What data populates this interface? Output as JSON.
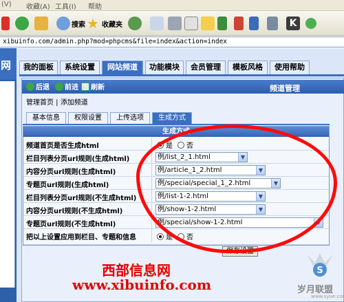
{
  "menubar": {
    "items": [
      "(V)",
      "收藏(A)",
      "工具(I)",
      "帮助"
    ]
  },
  "toolbar": {
    "search_label": "搜索",
    "favorites_label": "收藏夹"
  },
  "address": {
    "url": "xibuinfo.com/admin.php?mod=phpcms&file=index&action=index"
  },
  "sidebar": {
    "label": "网"
  },
  "nav": {
    "tabs": [
      "我的面板",
      "系统设置",
      "网站频道",
      "功能模块",
      "会员管理",
      "模板风格",
      "使用帮助"
    ],
    "active": "网站频道"
  },
  "panel": {
    "back_label": "后退",
    "forward_label": "前进",
    "refresh_label": "刷新",
    "title": "频道管理",
    "breadcrumb": "管理首页 | 添加频道"
  },
  "subtabs": {
    "items": [
      "基本信息",
      "权限设置",
      "上传选项",
      "生成方式"
    ],
    "active": "生成方式"
  },
  "settings": {
    "heading": "生成方式",
    "rows": [
      {
        "label": "频道首页是否生成html",
        "type": "radio",
        "opt1": "是",
        "opt2": "否",
        "selected": "是"
      },
      {
        "label": "栏目列表分页url规则(生成html)",
        "type": "select",
        "value": "例/list_2_1.html"
      },
      {
        "label": "内容分页url规则(生成html)",
        "type": "select",
        "value": "例/article_1_2.html"
      },
      {
        "label": "专题页url规则(生成html)",
        "type": "select",
        "value": "例/special/special_1_2.html"
      },
      {
        "label": "栏目列表分页url规则(不生成html)",
        "type": "select",
        "value": "例/list-1-2.html"
      },
      {
        "label": "内容分页url规则(不生成html)",
        "type": "select",
        "value": "例/show-1-2.html"
      },
      {
        "label": "专题页url规则(不生成html)",
        "type": "select",
        "value": "例/special/show-1-2.html"
      },
      {
        "label": "把以上设置应用到栏目、专题和信息",
        "type": "radio",
        "opt1": "是",
        "opt2": "否",
        "selected": "是"
      }
    ],
    "save_label": "保存设置"
  },
  "watermark": {
    "title": "西部信息网",
    "url": "www.xibuinfo.com",
    "logo_text": "岁月联盟",
    "logo_sub": "www.syue.com"
  },
  "colors": {
    "nav_blue": "#3b6fc2",
    "annotation_red": "#ff0a0a",
    "watermark_red": "#e60000"
  }
}
